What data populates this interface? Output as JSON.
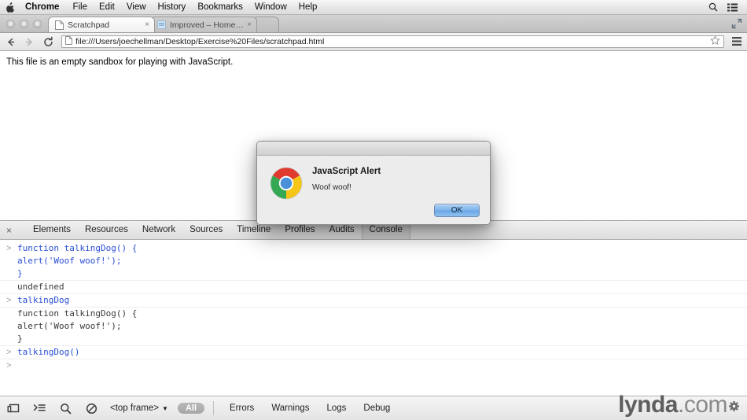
{
  "menubar": {
    "apple_icon": "apple-logo",
    "items": [
      {
        "label": "Chrome",
        "bold": true
      },
      {
        "label": "File",
        "bold": false
      },
      {
        "label": "Edit",
        "bold": false
      },
      {
        "label": "View",
        "bold": false
      },
      {
        "label": "History",
        "bold": false
      },
      {
        "label": "Bookmarks",
        "bold": false
      },
      {
        "label": "Window",
        "bold": false
      },
      {
        "label": "Help",
        "bold": false
      }
    ],
    "right_icons": [
      "search-icon",
      "list-menu-icon"
    ]
  },
  "browser": {
    "tabs": [
      {
        "title": "Scratchpad",
        "active": true,
        "close_glyph": "×",
        "favicon": "page-favicon"
      },
      {
        "title": "Improved – Home – Hans",
        "active": false,
        "close_glyph": "×",
        "favicon": "site-favicon"
      }
    ],
    "new_tab_glyph": "",
    "fullscreen_icon": "fullscreen-icon",
    "toolbar": {
      "back_icon": "back-arrow-icon",
      "forward_icon": "forward-arrow-icon",
      "reload_icon": "reload-icon",
      "url": "file:///Users/joechellman/Desktop/Exercise%20Files/scratchpad.html",
      "page_icon": "page-icon",
      "star_icon": "bookmark-star-icon",
      "menu_icon": "hamburger-menu-icon"
    }
  },
  "page": {
    "body_text": "This file is an empty sandbox for playing with JavaScript."
  },
  "alert": {
    "icon": "chrome-logo-icon",
    "heading": "JavaScript Alert",
    "message": "Woof woof!",
    "ok_label": "OK"
  },
  "devtools": {
    "close_glyph": "×",
    "tabs": [
      {
        "label": "Elements",
        "active": false
      },
      {
        "label": "Resources",
        "active": false
      },
      {
        "label": "Network",
        "active": false
      },
      {
        "label": "Sources",
        "active": false
      },
      {
        "label": "Timeline",
        "active": false
      },
      {
        "label": "Profiles",
        "active": false
      },
      {
        "label": "Audits",
        "active": false
      },
      {
        "label": "Console",
        "active": true
      }
    ],
    "console_lines": [
      {
        "prompt": ">",
        "text": "function talkingDog() {",
        "kind": "input"
      },
      {
        "prompt": "",
        "text": "alert('Woof woof!');",
        "kind": "input"
      },
      {
        "prompt": "",
        "text": "}",
        "kind": "input"
      },
      {
        "prompt": "",
        "text": "undefined",
        "kind": "output"
      },
      {
        "prompt": ">",
        "text": "talkingDog",
        "kind": "input"
      },
      {
        "prompt": "",
        "text": "function talkingDog() {",
        "kind": "output"
      },
      {
        "prompt": "",
        "text": "alert('Woof woof!');",
        "kind": "output"
      },
      {
        "prompt": "",
        "text": "}",
        "kind": "output"
      },
      {
        "prompt": ">",
        "text": "talkingDog()",
        "kind": "input"
      },
      {
        "prompt": ">",
        "text": "",
        "kind": "input"
      }
    ],
    "bottombar": {
      "dock_icon": "dock-panel-icon",
      "drawer_icon": "console-drawer-icon",
      "search_icon": "search-icon",
      "clear_icon": "clear-console-icon",
      "frame_label": "<top frame>",
      "frame_caret": "▼",
      "filter_all": "All",
      "filters": [
        "Errors",
        "Warnings",
        "Logs",
        "Debug"
      ]
    }
  },
  "watermark": {
    "bold_part": "lynda",
    "light_part": ".com",
    "gear_icon": "gear-icon"
  }
}
